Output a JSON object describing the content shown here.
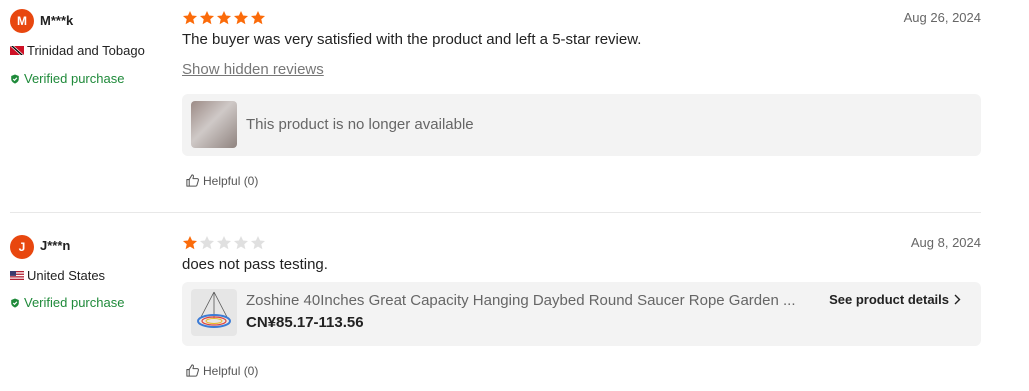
{
  "reviews": [
    {
      "avatar_letter": "M",
      "name": "M***k",
      "country": "Trinidad and Tobago",
      "verified": "Verified purchase",
      "rating": 5,
      "date": "Aug 26, 2024",
      "text": "The buyer was very satisfied with the product and left a 5-star review.",
      "show_hidden": "Show hidden reviews",
      "product_text": "This product is no longer available",
      "helpful": "Helpful (0)"
    },
    {
      "avatar_letter": "J",
      "name": "J***n",
      "country": "United States",
      "verified": "Verified purchase",
      "rating": 1,
      "date": "Aug 8, 2024",
      "text": "does not pass testing.",
      "product_title": "Zoshine 40Inches Great Capacity Hanging Daybed Round Saucer Rope Garden ...",
      "product_price": "CN¥85.17-113.56",
      "see_details": "See product details",
      "helpful": "Helpful (0)"
    }
  ],
  "colors": {
    "avatar": "#e8470f",
    "star_filled": "#fb6b0a",
    "star_empty": "#e0e0e0",
    "verified": "#1f8a3a"
  },
  "icons": {
    "verified": "shield-check-icon",
    "helpful": "thumbs-up-icon",
    "details": "chevron-right-icon"
  }
}
